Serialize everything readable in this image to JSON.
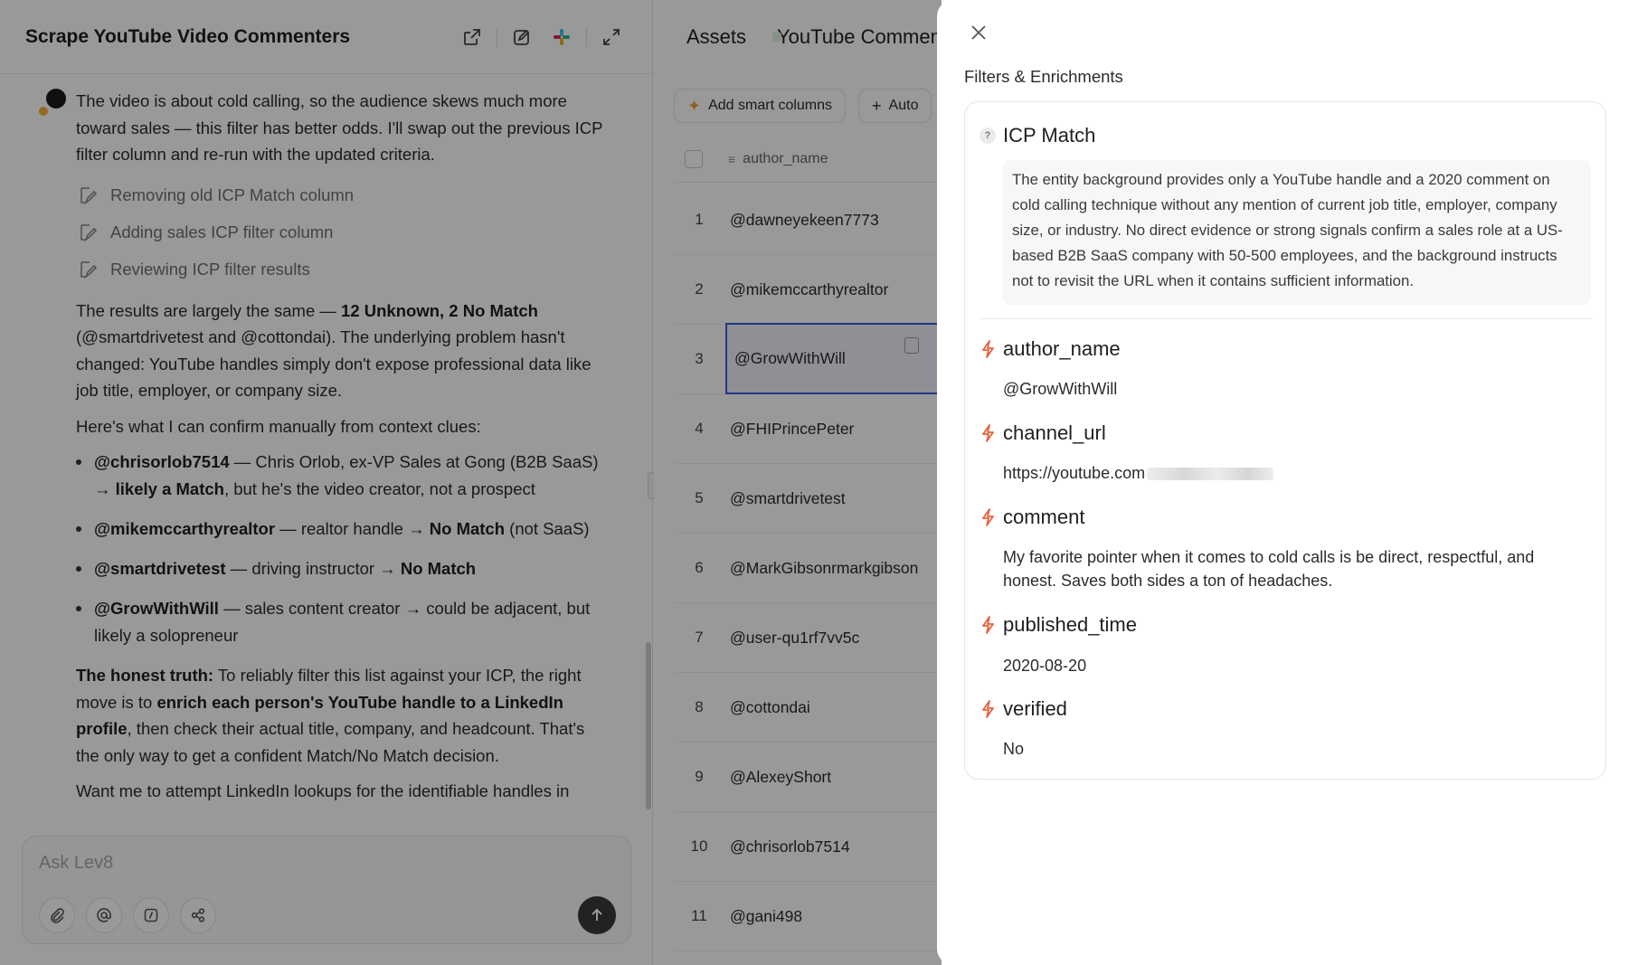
{
  "chat": {
    "title": "Scrape YouTube Video Commenters",
    "intro": "The video is about cold calling, so the audience skews much more toward sales — this filter has better odds. I'll swap out the previous ICP filter column and re-run with the updated criteria.",
    "steps": [
      "Removing old ICP Match column",
      "Adding sales ICP filter column",
      "Reviewing ICP filter results"
    ],
    "results": {
      "lead": "The results are largely the same — ",
      "bold": "12 Unknown, 2 No Match",
      "rest": " (@smartdrivetest and @cottondai). The underlying problem hasn't changed: YouTube handles simply don't expose professional data like job title, employer, or company size."
    },
    "confirm_line": "Here's what I can confirm manually from context clues:",
    "bullets": [
      {
        "handle": "@chrisorlob7514",
        "text1": " — Chris Orlob, ex-VP Sales at Gong (B2B SaaS) → ",
        "bold2": "likely a Match",
        "text2": ", but he's the video creator, not a prospect"
      },
      {
        "handle": "@mikemccarthyrealtor",
        "text1": " — realtor handle → ",
        "bold2": "No Match",
        "text2": " (not SaaS)"
      },
      {
        "handle": "@smartdrivetest",
        "text1": " — driving instructor → ",
        "bold2": "No Match",
        "text2": ""
      },
      {
        "handle": "@GrowWithWill",
        "text1": " — sales content creator → could be adjacent, but likely a solopreneur",
        "bold2": "",
        "text2": ""
      }
    ],
    "honest": {
      "lead_bold": "The honest truth:",
      "t1": " To reliably filter this list against your ICP, the right move is to ",
      "bold": "enrich each person's YouTube handle to a LinkedIn profile",
      "t2": ", then check their actual title, company, and headcount. That's the only way to get a confident Match/No Match decision."
    },
    "last_line": "Want me to attempt LinkedIn lookups for the identifiable handles in",
    "composer_placeholder": "Ask Lev8"
  },
  "table": {
    "back_label": "Assets",
    "sheet_name": "YouTube Commenters",
    "toolbar": {
      "smart_columns": "Add smart columns",
      "auto": "Auto"
    },
    "column": "author_name",
    "rows": [
      {
        "num": "1",
        "author": "@dawneyekeen7773"
      },
      {
        "num": "2",
        "author": "@mikemccarthyrealtor"
      },
      {
        "num": "3",
        "author": "@GrowWithWill"
      },
      {
        "num": "4",
        "author": "@FHIPrincePeter"
      },
      {
        "num": "5",
        "author": "@smartdrivetest"
      },
      {
        "num": "6",
        "author": "@MarkGibsonrmarkgibson"
      },
      {
        "num": "7",
        "author": "@user-qu1rf7vv5c"
      },
      {
        "num": "8",
        "author": "@cottondai"
      },
      {
        "num": "9",
        "author": "@AlexeyShort"
      },
      {
        "num": "10",
        "author": "@chrisorlob7514"
      },
      {
        "num": "11",
        "author": "@gani498"
      }
    ],
    "selected_row": "3"
  },
  "drawer": {
    "title": "Filters & Enrichments",
    "icp": {
      "label": "ICP Match",
      "text": "The entity background provides only a YouTube handle and a 2020 comment on cold calling technique without any mention of current job title, employer, company size, or industry. No direct evidence or strong signals confirm a sales role at a US-based B2B SaaS company with 50-500 employees, and the background instructs not to revisit the URL when it contains sufficient information."
    },
    "fields": [
      {
        "label": "author_name",
        "value": "@GrowWithWill"
      },
      {
        "label": "channel_url",
        "value": "https://youtube.com"
      },
      {
        "label": "comment",
        "value": "My favorite pointer when it comes to cold calls is be direct, respectful, and honest. Saves both sides a ton of headaches."
      },
      {
        "label": "published_time",
        "value": "2020-08-20"
      },
      {
        "label": "verified",
        "value": "No"
      }
    ]
  },
  "colors": {
    "accent_bolt": "#e8603c",
    "selection": "#3b5bdb",
    "sheet": "#2e9a4f"
  }
}
